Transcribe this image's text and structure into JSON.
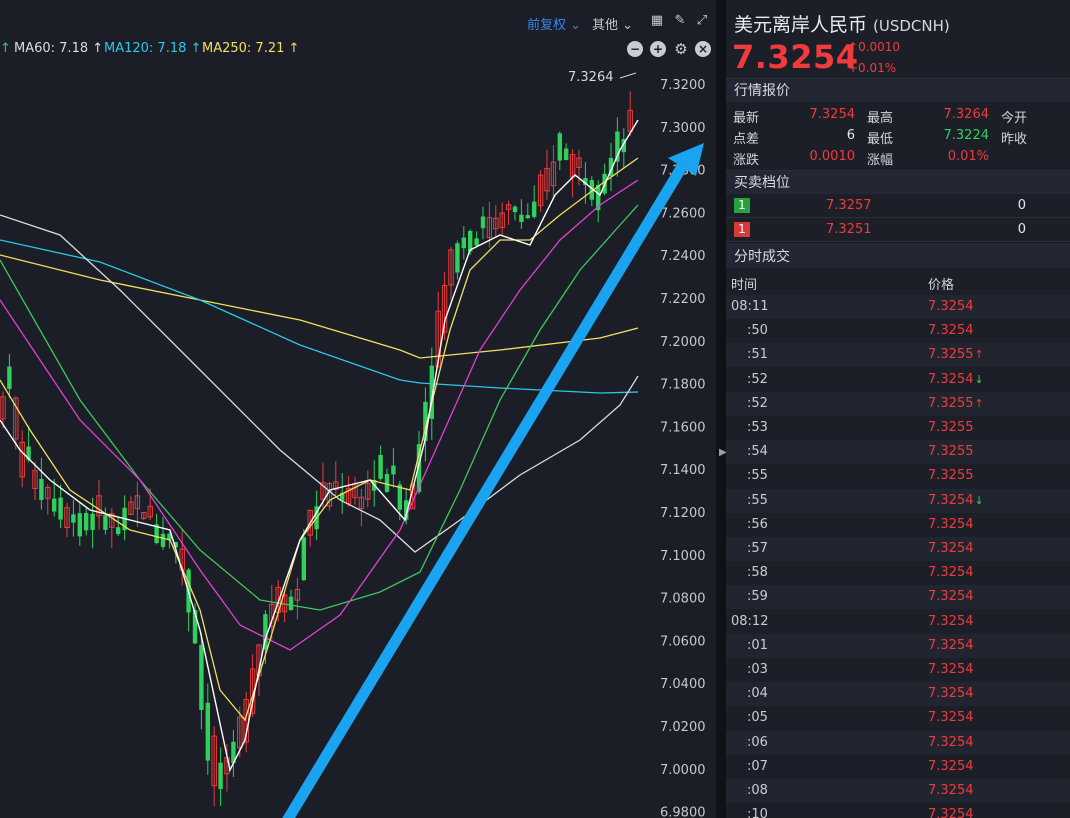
{
  "toolbar": {
    "adjust_label": "前复权",
    "other_label": "其他",
    "grid_icon": "grid-icon",
    "draw_icon": "pen-icon",
    "expand_icon": "expand-icon"
  },
  "indicators": [
    {
      "label": "MA60: 7.18",
      "arrow": "↑",
      "color": "#d9dde4"
    },
    {
      "label": "MA120: 7.18",
      "arrow": "↑",
      "color": "#28c8e6"
    },
    {
      "label": "MA250: 7.21",
      "arrow": "↑",
      "color": "#f0e060"
    }
  ],
  "indicator_controls": [
    "minus-icon",
    "plus-icon",
    "gear-icon",
    "close-icon"
  ],
  "chart": {
    "max_marker": "7.3264",
    "price_axis": [
      "7.3200",
      "7.3000",
      "7.2800",
      "7.2600",
      "7.2400",
      "7.2200",
      "7.2000",
      "7.1800",
      "7.1600",
      "7.1400",
      "7.1200",
      "7.1000",
      "7.0800",
      "7.0600",
      "7.0400",
      "7.0200",
      "7.0000",
      "6.9800"
    ],
    "colors": {
      "up": "#ef3b3b",
      "down": "#2fd05b",
      "arrow": "#1aa3f0"
    }
  },
  "quote": {
    "name": "美元离岸人民币",
    "code": "(USDCNH)",
    "price": "7.3254",
    "change": "0.0010",
    "change_pct": "+0.01%",
    "section_quote": "行情报价",
    "fields": {
      "latest_label": "最新",
      "latest": "7.3254",
      "high_label": "最高",
      "high": "7.3264",
      "open_label": "今开",
      "points_label": "点差",
      "points": "6",
      "low_label": "最低",
      "low": "7.3224",
      "prevclose_label": "昨收",
      "chg_label": "涨跌",
      "chg": "0.0010",
      "chgpct_label": "涨幅",
      "chgpct": "0.01%"
    },
    "section_book": "买卖档位",
    "book": [
      {
        "level": "1",
        "price": "7.3257",
        "volume": "0",
        "side": "sell"
      },
      {
        "level": "1",
        "price": "7.3251",
        "volume": "0",
        "side": "buy"
      }
    ],
    "section_ticks": "分时成交",
    "ticks_head": {
      "time": "时间",
      "price": "价格"
    },
    "ticks": [
      {
        "time": "08:11",
        "price": "7.3254",
        "dir": ""
      },
      {
        "time": ":50",
        "price": "7.3254",
        "dir": ""
      },
      {
        "time": ":51",
        "price": "7.3255",
        "dir": "up"
      },
      {
        "time": ":52",
        "price": "7.3254",
        "dir": "down"
      },
      {
        "time": ":52",
        "price": "7.3255",
        "dir": "up"
      },
      {
        "time": ":53",
        "price": "7.3255",
        "dir": ""
      },
      {
        "time": ":54",
        "price": "7.3255",
        "dir": ""
      },
      {
        "time": ":55",
        "price": "7.3255",
        "dir": ""
      },
      {
        "time": ":55",
        "price": "7.3254",
        "dir": "down"
      },
      {
        "time": ":56",
        "price": "7.3254",
        "dir": ""
      },
      {
        "time": ":57",
        "price": "7.3254",
        "dir": ""
      },
      {
        "time": ":58",
        "price": "7.3254",
        "dir": ""
      },
      {
        "time": ":59",
        "price": "7.3254",
        "dir": ""
      },
      {
        "time": "08:12",
        "price": "7.3254",
        "dir": ""
      },
      {
        "time": ":01",
        "price": "7.3254",
        "dir": ""
      },
      {
        "time": ":03",
        "price": "7.3254",
        "dir": ""
      },
      {
        "time": ":04",
        "price": "7.3254",
        "dir": ""
      },
      {
        "time": ":05",
        "price": "7.3254",
        "dir": ""
      },
      {
        "time": ":06",
        "price": "7.3254",
        "dir": ""
      },
      {
        "time": ":07",
        "price": "7.3254",
        "dir": ""
      },
      {
        "time": ":08",
        "price": "7.3254",
        "dir": ""
      },
      {
        "time": ":10",
        "price": "7.3254",
        "dir": ""
      }
    ]
  }
}
